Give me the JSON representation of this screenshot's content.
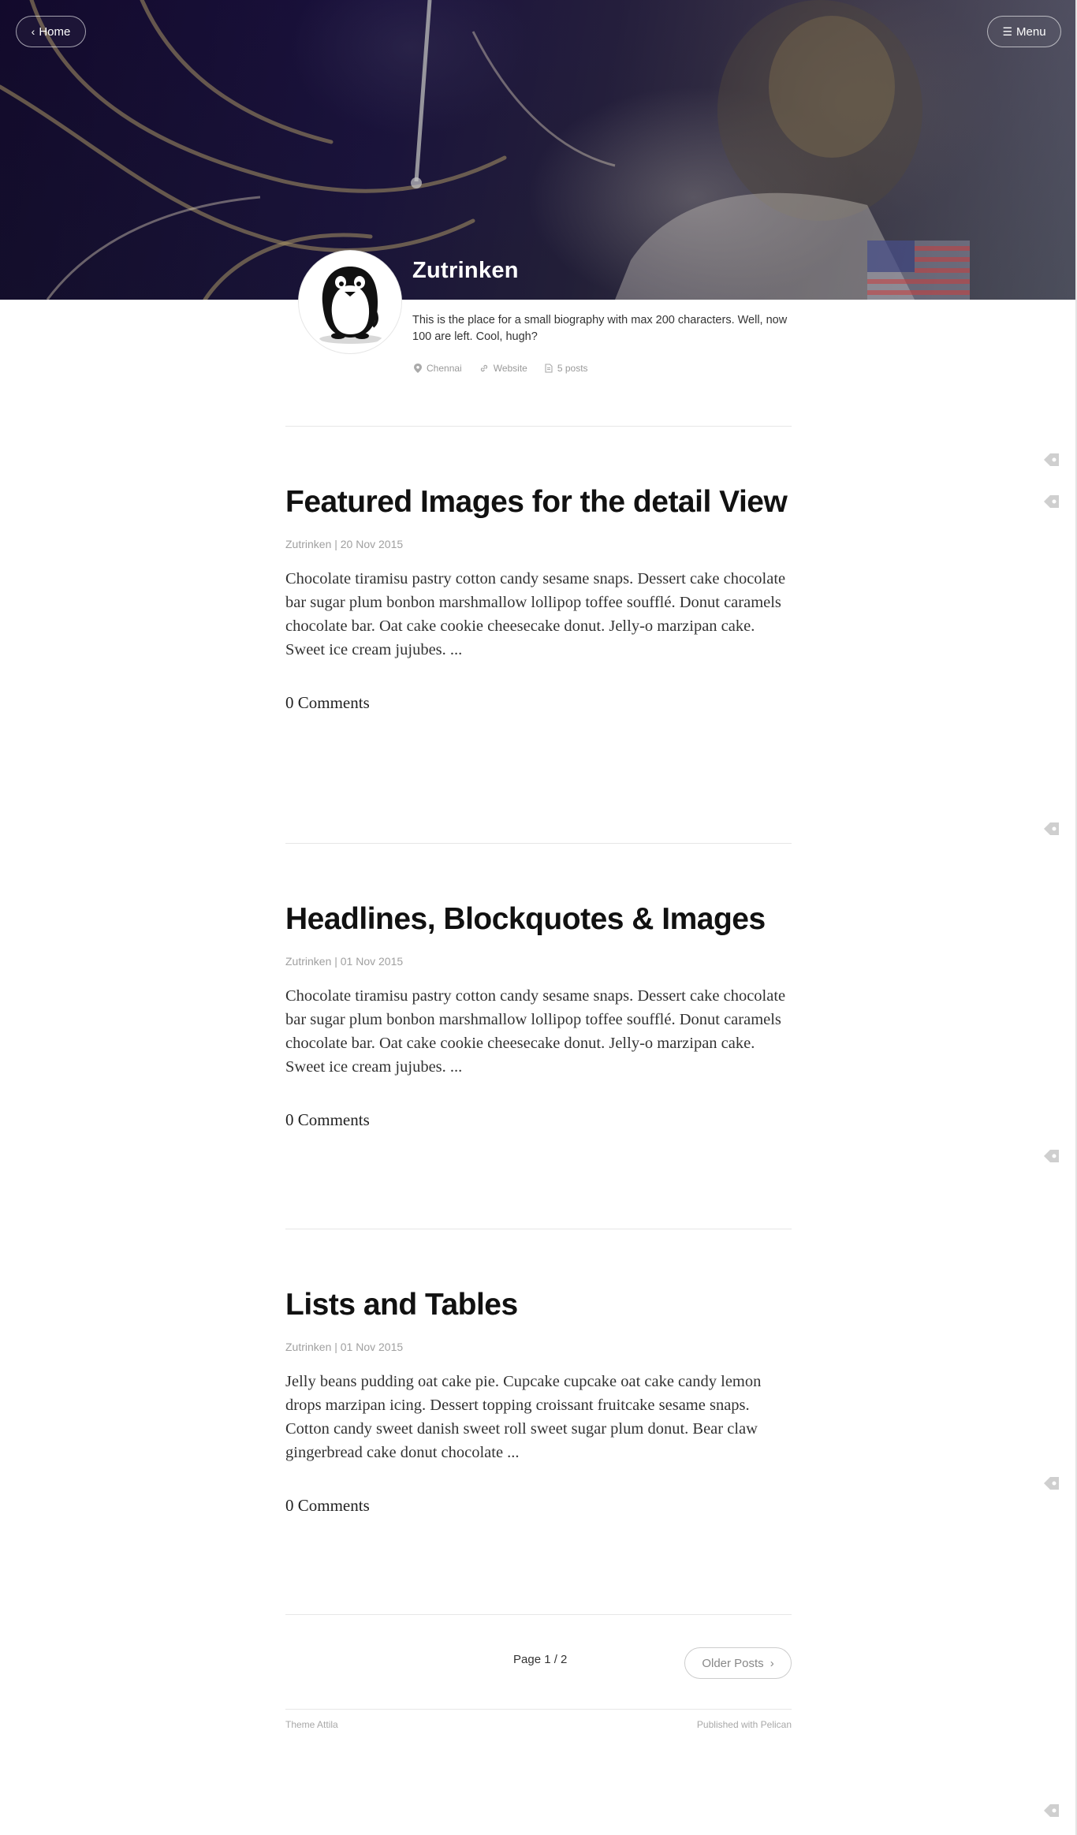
{
  "nav": {
    "home_label": "Home",
    "menu_label": "Menu",
    "home_icon": "chevron-left-icon",
    "menu_icon": "hamburger-icon"
  },
  "author": {
    "name": "Zutrinken",
    "bio": "This is the place for a small biography with max 200 characters. Well, now 100 are left. Cool, hugh?",
    "location": "Chennai",
    "website": "Website",
    "posts": "5 posts"
  },
  "posts": [
    {
      "title": "Featured Images for the detail View",
      "meta": "Zutrinken | 20 Nov 2015",
      "excerpt": "Chocolate tiramisu pastry cotton candy sesame snaps. Dessert cake chocolate bar sugar plum bonbon marshmallow lollipop toffee soufflé. Donut caramels chocolate bar. Oat cake cookie cheesecake donut. Jelly-o marzipan cake. Sweet ice cream jujubes. ...",
      "comments": "0 Comments"
    },
    {
      "title": "Headlines, Blockquotes & Images",
      "meta": "Zutrinken | 01 Nov 2015",
      "excerpt": "Chocolate tiramisu pastry cotton candy sesame snaps. Dessert cake chocolate bar sugar plum bonbon marshmallow lollipop toffee soufflé. Donut caramels chocolate bar. Oat cake cookie cheesecake donut. Jelly-o marzipan cake. Sweet ice cream jujubes. ...",
      "comments": "0 Comments"
    },
    {
      "title": "Lists and Tables",
      "meta": "Zutrinken | 01 Nov 2015",
      "excerpt": "Jelly beans pudding oat cake pie. Cupcake cupcake oat cake candy lemon drops marzipan icing. Dessert topping croissant fruitcake sesame snaps. Cotton candy sweet danish sweet roll sweet sugar plum donut. Bear claw gingerbread cake donut chocolate ...",
      "comments": "0 Comments"
    }
  ],
  "pagination": {
    "page": "Page 1 / 2",
    "older": "Older Posts"
  },
  "footer": {
    "theme": "Theme Attila",
    "published": "Published with Pelican"
  },
  "colors": {
    "hero_dark": "#1c1440",
    "text": "#333333",
    "muted": "#a0a0a0"
  }
}
